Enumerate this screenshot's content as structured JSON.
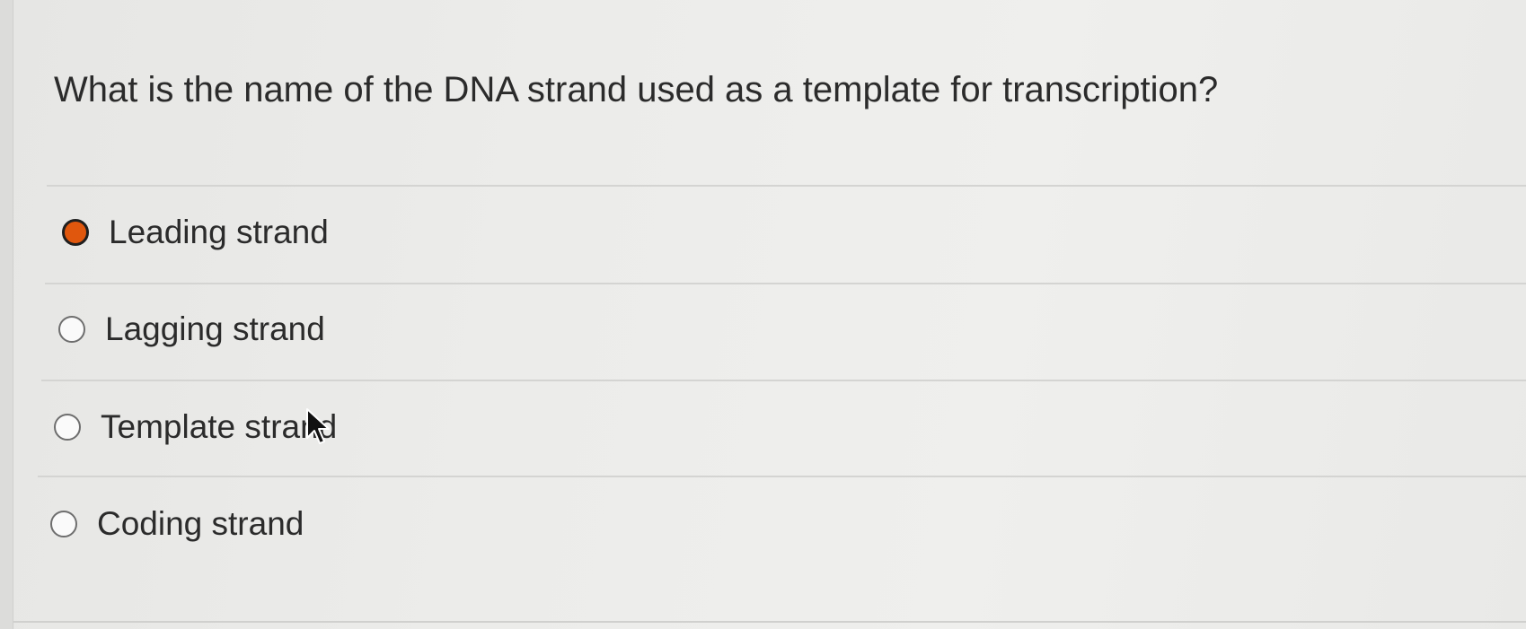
{
  "question": {
    "text": "What is the name of the DNA strand used as a template for transcription?"
  },
  "options": [
    {
      "label": "Leading strand",
      "selected": true
    },
    {
      "label": "Lagging strand",
      "selected": false
    },
    {
      "label": "Template strand",
      "selected": false
    },
    {
      "label": "Coding strand",
      "selected": false
    }
  ],
  "colors": {
    "selected_radio": "#e0570d",
    "text": "#2b2b2b"
  },
  "icons": {
    "cursor": "mouse-pointer-icon"
  }
}
